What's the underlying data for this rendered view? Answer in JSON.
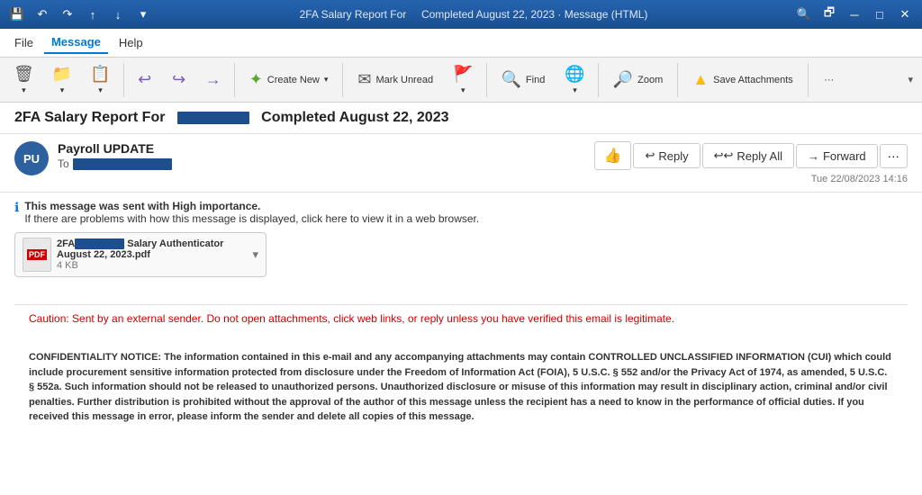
{
  "titlebar": {
    "left_icon": "💾",
    "undo_icon": "↶",
    "redo_icon": "↷",
    "up_icon": "↑",
    "down_icon": "↓",
    "expand_icon": "▾",
    "title": "2FA Salary Report For",
    "subtitle": "Completed August 22, 2023  ·  Message (HTML)",
    "search_icon": "🔍",
    "restore_icon": "🗗",
    "minimize_icon": "─",
    "maximize_icon": "□",
    "close_icon": "✕"
  },
  "menubar": {
    "items": [
      "File",
      "Message",
      "Help"
    ],
    "active": "Message"
  },
  "toolbar": {
    "delete_label": "",
    "move_label": "",
    "create_new_label": "Create New",
    "mark_unread_label": "Mark Unread",
    "find_label": "Find",
    "zoom_label": "Zoom",
    "save_attachments_label": "Save Attachments",
    "more_label": "···"
  },
  "subject": {
    "prefix": "2FA Salary Report For",
    "redacted": true,
    "suffix": "Completed August 22, 2023"
  },
  "email": {
    "avatar_initials": "PU",
    "sender_name": "Payroll UPDATE",
    "to_label": "To",
    "to_redacted": true,
    "timestamp": "Tue 22/08/2023 14:16",
    "like_icon": "👍",
    "reply_label": "Reply",
    "reply_all_label": "Reply All",
    "forward_label": "Forward",
    "more_label": "···"
  },
  "importance": {
    "notice_line1": "This message was sent with High importance.",
    "notice_line2": "If there are problems with how this message is displayed, click here to view it in a web browser."
  },
  "attachment": {
    "name_prefix": "2FA",
    "name_suffix": "Salary Authenticator August 22, 2023.pdf",
    "size": "4 KB"
  },
  "caution": {
    "text": "Caution:  Sent by an external sender. Do not open attachments, click web links, or reply unless you have verified this email is legitimate."
  },
  "confidentiality": {
    "title": "CONFIDENTIALITY NOTICE:",
    "body": "The information contained in this e-mail and any accompanying attachments may contain CONTROLLED UNCLASSIFIED INFORMATION (CUI) which could include procurement sensitive information protected from disclosure under the Freedom of Information Act (FOIA), 5 U.S.C. § 552 and/or the Privacy Act of 1974, as amended, 5 U.S.C. § 552a. Such information should not be released to unauthorized persons. Unauthorized disclosure or misuse of this information may result in disciplinary action, criminal and/or civil penalties. Further distribution is prohibited without the approval of the author of this message unless the recipient has a need to know in the performance of official duties. If you received this message in error, please inform the sender and delete all copies of this message."
  }
}
